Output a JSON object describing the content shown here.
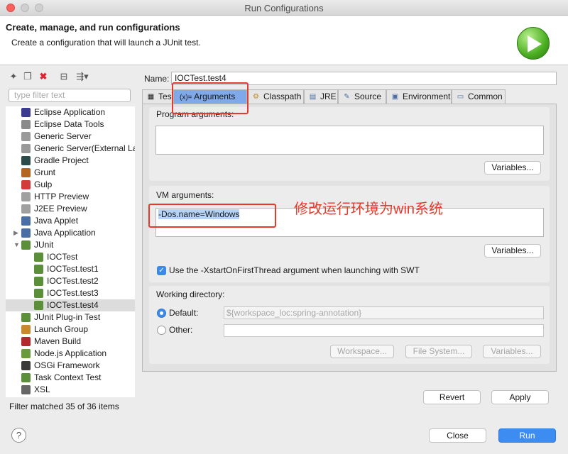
{
  "window": {
    "title": "Run Configurations"
  },
  "header": {
    "title": "Create, manage, and run configurations",
    "subtitle": "Create a configuration that will launch a JUnit test."
  },
  "filter": {
    "placeholder": "type filter text"
  },
  "tree": [
    {
      "label": "Eclipse Application",
      "icon": "eclipse-icon",
      "color": "#3b3b8f"
    },
    {
      "label": "Eclipse Data Tools",
      "icon": "database-icon",
      "color": "#8a8a8a"
    },
    {
      "label": "Generic Server",
      "icon": "server-icon",
      "color": "#9a9a9a"
    },
    {
      "label": "Generic Server(External La",
      "icon": "server-icon",
      "color": "#9a9a9a"
    },
    {
      "label": "Gradle Project",
      "icon": "gradle-elephant-icon",
      "color": "#2b4a4a"
    },
    {
      "label": "Grunt",
      "icon": "grunt-icon",
      "color": "#b5651d"
    },
    {
      "label": "Gulp",
      "icon": "gulp-icon",
      "color": "#d13b3b"
    },
    {
      "label": "HTTP Preview",
      "icon": "document-icon",
      "color": "#a0a0a0"
    },
    {
      "label": "J2EE Preview",
      "icon": "document-icon",
      "color": "#a0a0a0"
    },
    {
      "label": "Java Applet",
      "icon": "applet-icon",
      "color": "#4a6fa5"
    },
    {
      "label": "Java Application",
      "icon": "java-app-icon",
      "color": "#4a6fa5",
      "expandable": true
    },
    {
      "label": "JUnit",
      "icon": "junit-icon",
      "color": "#5b8f3a",
      "expanded": true
    },
    {
      "label": "IOCTest",
      "icon": "junit-icon",
      "color": "#5b8f3a",
      "child": true
    },
    {
      "label": "IOCTest.test1",
      "icon": "junit-icon",
      "color": "#5b8f3a",
      "child": true
    },
    {
      "label": "IOCTest.test2",
      "icon": "junit-icon",
      "color": "#5b8f3a",
      "child": true
    },
    {
      "label": "IOCTest.test3",
      "icon": "junit-icon",
      "color": "#5b8f3a",
      "child": true
    },
    {
      "label": "IOCTest.test4",
      "icon": "junit-icon",
      "color": "#5b8f3a",
      "child": true,
      "selected": true
    },
    {
      "label": "JUnit Plug-in Test",
      "icon": "junit-icon",
      "color": "#5b8f3a"
    },
    {
      "label": "Launch Group",
      "icon": "launch-group-icon",
      "color": "#c98a2b"
    },
    {
      "label": "Maven Build",
      "icon": "maven-icon",
      "color": "#b3282d"
    },
    {
      "label": "Node.js Application",
      "icon": "nodejs-icon",
      "color": "#6a9a3c"
    },
    {
      "label": "OSGi Framework",
      "icon": "osgi-icon",
      "color": "#3a3a3a"
    },
    {
      "label": "Task Context Test",
      "icon": "junit-icon",
      "color": "#5b8f3a"
    },
    {
      "label": "XSL",
      "icon": "xsl-icon",
      "color": "#666666"
    }
  ],
  "filter_status": "Filter matched 35 of 36 items",
  "config": {
    "name_label": "Name:",
    "name_value": "IOCTest.test4",
    "tabs": [
      {
        "label": "Tes",
        "icon": "test-icon"
      },
      {
        "label": "Arguments",
        "icon_text": "(x)=",
        "active": true
      },
      {
        "label": "Classpath",
        "icon": "classpath-icon"
      },
      {
        "label": "JRE",
        "icon": "jre-icon"
      },
      {
        "label": "Source",
        "icon": "source-icon"
      },
      {
        "label": "Environment",
        "icon": "environment-icon"
      },
      {
        "label": "Common",
        "icon": "common-icon"
      }
    ],
    "program_args_label": "Program arguments:",
    "program_args_value": "",
    "vm_args_label": "VM arguments:",
    "vm_args_value": "-Dos.name=Windows",
    "variables_label": "Variables...",
    "use_xstart_label": "Use the -XstartOnFirstThread argument when launching with SWT",
    "use_xstart_checked": true,
    "workdir_label": "Working directory:",
    "default_label": "Default:",
    "default_value": "${workspace_loc:spring-annotation}",
    "other_label": "Other:",
    "other_value": "",
    "workspace_btn": "Workspace...",
    "filesystem_btn": "File System...",
    "variables_btn": "Variables..."
  },
  "annotation": "修改运行环境为win系统",
  "buttons": {
    "revert": "Revert",
    "apply": "Apply",
    "close": "Close",
    "run": "Run"
  },
  "colors": {
    "accent": "#3c8cf1",
    "highlight": "#e53a2a",
    "active_tab": "#7fa9e8"
  }
}
